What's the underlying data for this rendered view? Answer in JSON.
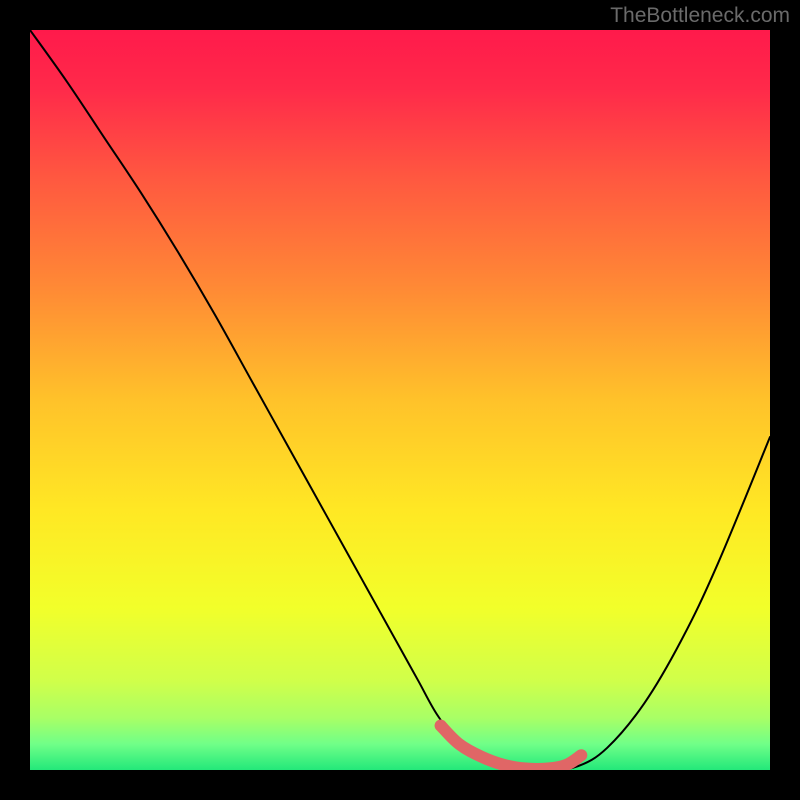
{
  "attribution": "TheBottleneck.com",
  "chart_data": {
    "type": "line",
    "title": "",
    "xlabel": "",
    "ylabel": "",
    "xlim": [
      0,
      1
    ],
    "ylim": [
      0,
      1
    ],
    "series": [
      {
        "name": "bottleneck-curve",
        "x": [
          0.0,
          0.05,
          0.1,
          0.15,
          0.2,
          0.25,
          0.3,
          0.35,
          0.4,
          0.45,
          0.5,
          0.525,
          0.55,
          0.58,
          0.6,
          0.63,
          0.66,
          0.7,
          0.74,
          0.78,
          0.83,
          0.88,
          0.93,
          1.0
        ],
        "values": [
          1.0,
          0.93,
          0.855,
          0.78,
          0.7,
          0.615,
          0.525,
          0.435,
          0.345,
          0.255,
          0.165,
          0.12,
          0.075,
          0.035,
          0.018,
          0.006,
          0.0,
          0.0,
          0.005,
          0.03,
          0.09,
          0.175,
          0.28,
          0.45
        ]
      }
    ],
    "highlight": {
      "name": "optimal-range",
      "x": [
        0.555,
        0.58,
        0.61,
        0.64,
        0.67,
        0.7,
        0.725,
        0.745
      ],
      "values": [
        0.06,
        0.035,
        0.018,
        0.007,
        0.002,
        0.002,
        0.007,
        0.02
      ]
    },
    "gradient_stops": [
      {
        "offset": 0.0,
        "color": "#ff1a4b"
      },
      {
        "offset": 0.08,
        "color": "#ff2a4a"
      },
      {
        "offset": 0.2,
        "color": "#ff5840"
      },
      {
        "offset": 0.35,
        "color": "#ff8a35"
      },
      {
        "offset": 0.5,
        "color": "#ffc22a"
      },
      {
        "offset": 0.65,
        "color": "#ffe824"
      },
      {
        "offset": 0.78,
        "color": "#f2ff2a"
      },
      {
        "offset": 0.88,
        "color": "#d0ff4a"
      },
      {
        "offset": 0.93,
        "color": "#a8ff66"
      },
      {
        "offset": 0.965,
        "color": "#70ff88"
      },
      {
        "offset": 1.0,
        "color": "#23e87a"
      }
    ],
    "highlight_color": "#e06666",
    "curve_color": "#000000"
  }
}
